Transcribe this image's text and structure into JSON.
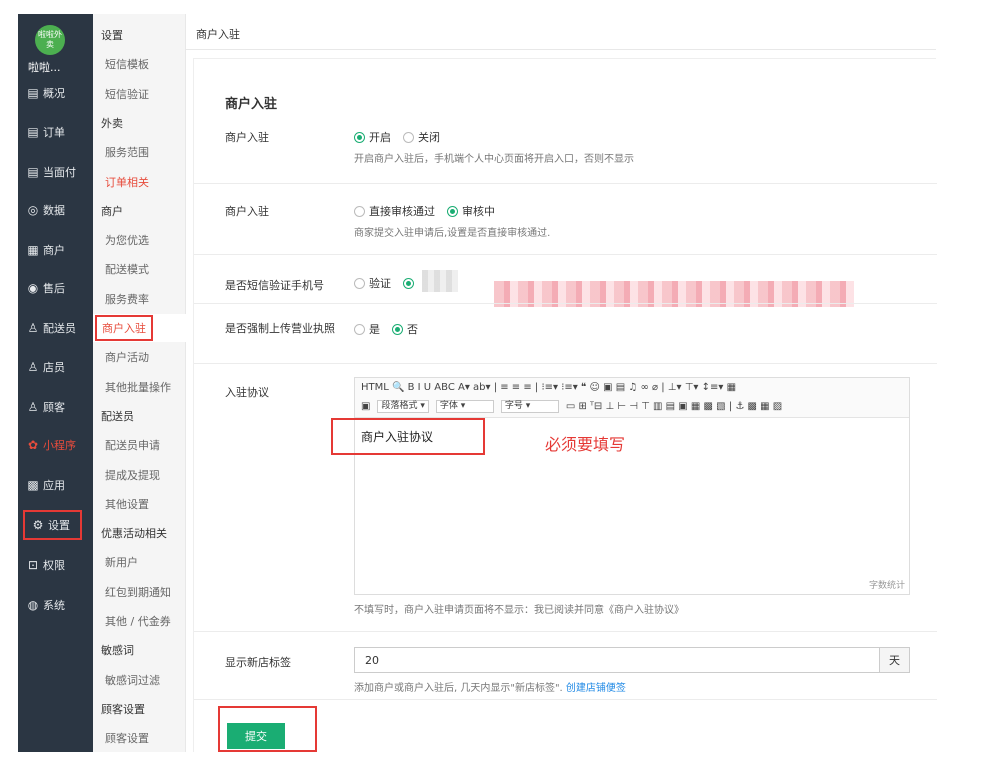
{
  "app": {
    "logo_text": "啦啦外卖",
    "name": "啦啦..."
  },
  "rail": [
    {
      "icon": "▤",
      "icon_name": "dashboard-icon",
      "label": "概况"
    },
    {
      "icon": "▤",
      "icon_name": "order-icon",
      "label": "订单"
    },
    {
      "icon": "▤",
      "icon_name": "counter-pay-icon",
      "label": "当面付"
    },
    {
      "icon": "◎",
      "icon_name": "stats-icon",
      "label": "数据"
    },
    {
      "icon": "▦",
      "icon_name": "shop-icon",
      "label": "商户"
    },
    {
      "icon": "◉",
      "icon_name": "aftersale-icon",
      "label": "售后"
    },
    {
      "icon": "♙",
      "icon_name": "courier-icon",
      "label": "配送员"
    },
    {
      "icon": "♙",
      "icon_name": "clerk-icon",
      "label": "店员"
    },
    {
      "icon": "♙",
      "icon_name": "customer-icon",
      "label": "顾客"
    },
    {
      "icon": "✿",
      "icon_name": "miniprogram-icon",
      "label": "小程序"
    },
    {
      "icon": "▩",
      "icon_name": "apps-icon",
      "label": "应用"
    },
    {
      "icon": "⚙",
      "icon_name": "settings-icon",
      "label": "设置"
    },
    {
      "icon": "⊡",
      "icon_name": "permission-icon",
      "label": "权限"
    },
    {
      "icon": "◍",
      "icon_name": "system-icon",
      "label": "系统"
    }
  ],
  "submenu": [
    {
      "label": "设置",
      "type": "head"
    },
    {
      "label": "短信模板",
      "type": "link"
    },
    {
      "label": "短信验证",
      "type": "link"
    },
    {
      "label": "外卖",
      "type": "head"
    },
    {
      "label": "服务范围",
      "type": "link"
    },
    {
      "label": "订单相关",
      "type": "link"
    },
    {
      "label": "商户",
      "type": "head"
    },
    {
      "label": "为您优选",
      "type": "link"
    },
    {
      "label": "配送模式",
      "type": "link"
    },
    {
      "label": "服务费率",
      "type": "link"
    },
    {
      "label": "商户入驻",
      "type": "link"
    },
    {
      "label": "商户活动",
      "type": "link"
    },
    {
      "label": "其他批量操作",
      "type": "link"
    },
    {
      "label": "配送员",
      "type": "head"
    },
    {
      "label": "配送员申请",
      "type": "link"
    },
    {
      "label": "提成及提现",
      "type": "link"
    },
    {
      "label": "其他设置",
      "type": "link"
    },
    {
      "label": "优惠活动相关",
      "type": "head"
    },
    {
      "label": "新用户",
      "type": "link"
    },
    {
      "label": "红包到期通知",
      "type": "link"
    },
    {
      "label": "其他 / 代金券",
      "type": "link"
    },
    {
      "label": "敏感词",
      "type": "head"
    },
    {
      "label": "敏感词过滤",
      "type": "link"
    },
    {
      "label": "顾客设置",
      "type": "head"
    },
    {
      "label": "顾客设置",
      "type": "link"
    }
  ],
  "breadcrumb": "商户入驻",
  "form": {
    "title": "商户入驻",
    "switch": {
      "label": "商户入驻",
      "opt_on": "开启",
      "opt_off": "关闭",
      "help": "开启商户入驻后，手机端个人中心页面将开启入口，否则不显示"
    },
    "review": {
      "label": "商户入驻",
      "opt_direct": "直接审核通过",
      "opt_review": "审核中",
      "help": "商家提交入驻申请后,设置是否直接审核通过."
    },
    "sms": {
      "label": "是否短信验证手机号",
      "opt_verify": "验证"
    },
    "license": {
      "label": "是否强制上传营业执照",
      "opt_yes": "是",
      "opt_no": "否"
    },
    "agreement": {
      "label": "入驻协议",
      "toolbar_row1": "HTML  🔍  B  I  U  ABC  A▾  ab▾  |  ≡  ≡  ≡  |  ⁝≡▾  ⁝≡▾  ❝  ☺  ▣  ▤  ♫  ∞  ⌀  |  ⊥▾  ⊤▾  ↕≡▾  ▦",
      "toolbar_row1_end": "▦",
      "para_select": "段落格式",
      "font_select": "字体",
      "size_select": "字号",
      "toolbar_row2": "▭  ⊞  ᵀ⊟  ⊥  ⊢  ⊣  ⊤  ▥  ▤  ▣  ▦  ▩  ▧  |  ⚓  ▩  ▦  ▨",
      "content": "商户入驻协议",
      "word_count": "字数统计",
      "help": "不填写时，商户入驻申请页面将不显示：我已阅读并同意《商户入驻协议》"
    },
    "new_tag": {
      "label": "显示新店标签",
      "value": "20",
      "unit": "天",
      "help": "添加商户或商户入驻后, 几天内显示\"新店标签\". ",
      "help_link": "创建店铺便签"
    },
    "submit": "提交"
  },
  "annotation": "必须要填写",
  "colors": {
    "accent": "#1aad73",
    "red": "#e53935",
    "rail": "#2b3643"
  }
}
